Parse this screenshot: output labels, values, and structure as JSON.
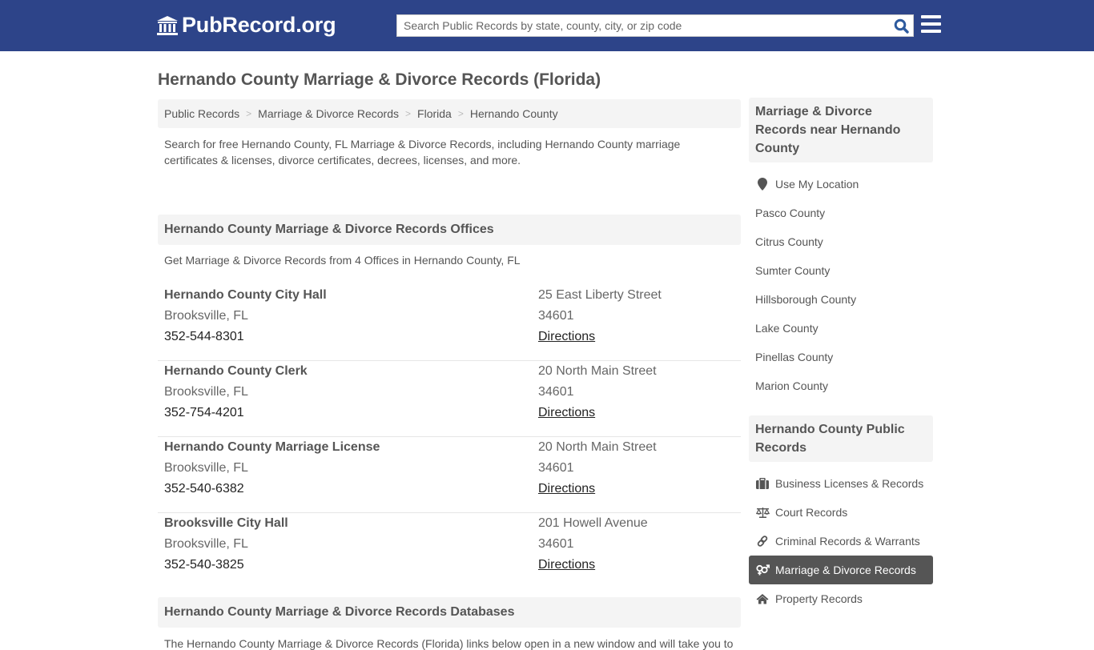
{
  "header": {
    "logo_text": "PubRecord.org",
    "search_placeholder": "Search Public Records by state, county, city, or zip code",
    "brand_color": "#2d4489"
  },
  "page_title": "Hernando County Marriage & Divorce Records (Florida)",
  "breadcrumb": [
    {
      "label": "Public Records"
    },
    {
      "label": "Marriage & Divorce Records"
    },
    {
      "label": "Florida"
    },
    {
      "label": "Hernando County"
    }
  ],
  "intro": "Search for free Hernando County, FL Marriage & Divorce Records, including Hernando County marriage certificates & licenses, divorce certificates, decrees, licenses, and more.",
  "offices_section": {
    "title": "Hernando County Marriage & Divorce Records Offices",
    "subtitle": "Get Marriage & Divorce Records from 4 Offices in Hernando County, FL",
    "offices": [
      {
        "name": "Hernando County City Hall",
        "city": "Brooksville, FL",
        "phone": "352-544-8301",
        "street": "25 East Liberty Street",
        "zip": "34601",
        "directions": "Directions"
      },
      {
        "name": "Hernando County Clerk",
        "city": "Brooksville, FL",
        "phone": "352-754-4201",
        "street": "20 North Main Street",
        "zip": "34601",
        "directions": "Directions"
      },
      {
        "name": "Hernando County Marriage License",
        "city": "Brooksville, FL",
        "phone": "352-540-6382",
        "street": "20 North Main Street",
        "zip": "34601",
        "directions": "Directions"
      },
      {
        "name": "Brooksville City Hall",
        "city": "Brooksville, FL",
        "phone": "352-540-3825",
        "street": "201 Howell Avenue",
        "zip": "34601",
        "directions": "Directions"
      }
    ]
  },
  "databases_section": {
    "title": "Hernando County Marriage & Divorce Records Databases",
    "text": "The Hernando County Marriage & Divorce Records (Florida) links below open in a new window and will take you to"
  },
  "sidebar": {
    "nearby": {
      "title": "Marriage & Divorce Records near Hernando County",
      "use_location": "Use My Location",
      "counties": [
        "Pasco County",
        "Citrus County",
        "Sumter County",
        "Hillsborough County",
        "Lake County",
        "Pinellas County",
        "Marion County"
      ]
    },
    "public_records": {
      "title": "Hernando County Public Records",
      "items": [
        {
          "label": "Business Licenses & Records",
          "icon": "briefcase-icon",
          "active": false
        },
        {
          "label": "Court Records",
          "icon": "scale-icon",
          "active": false
        },
        {
          "label": "Criminal Records & Warrants",
          "icon": "link-icon",
          "active": false
        },
        {
          "label": "Marriage & Divorce Records",
          "icon": "gender-icon",
          "active": true
        },
        {
          "label": "Property Records",
          "icon": "home-icon",
          "active": false
        }
      ]
    }
  }
}
